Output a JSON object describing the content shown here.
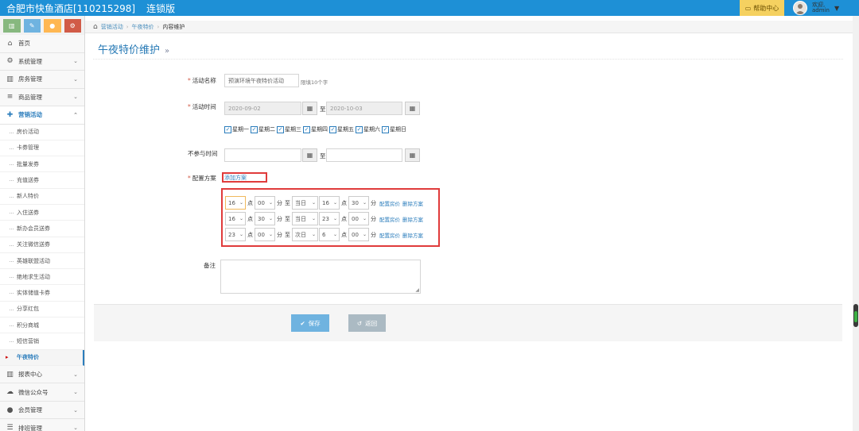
{
  "app": {
    "hotel_name": "合肥市快鱼酒店[110215298]",
    "edition": "连锁版",
    "help_label": "帮助中心",
    "welcome": "欢迎,",
    "username": "admin"
  },
  "sidebar": {
    "shortcuts": [
      "chart-icon",
      "pencil-icon",
      "users-icon",
      "cogs-icon"
    ],
    "top_items": [
      {
        "label": "首页",
        "icon": "home-icon"
      },
      {
        "label": "系统管理",
        "icon": "gear-icon"
      },
      {
        "label": "房务管理",
        "icon": "bank-icon"
      },
      {
        "label": "商品管理",
        "icon": "database-icon"
      },
      {
        "label": "营销活动",
        "icon": "gift-icon"
      }
    ],
    "marketing_sub": [
      "房价活动",
      "卡券管理",
      "批量发券",
      "充值送券",
      "新人特价",
      "入住送券",
      "新办会员送券",
      "关注微信送券",
      "英雄联盟活动",
      "绝地求生活动",
      "实体储值卡券",
      "分享红包",
      "积分商城",
      "短信营销",
      "午夜特价"
    ],
    "bottom_items": [
      {
        "label": "报表中心",
        "icon": "bar-chart-icon"
      },
      {
        "label": "微信公众号",
        "icon": "cloud-icon"
      },
      {
        "label": "会员管理",
        "icon": "group-icon"
      },
      {
        "label": "排班管理",
        "icon": "list-icon"
      }
    ]
  },
  "breadcrumb": {
    "items": [
      "营销活动",
      "午夜特价",
      "内容维护"
    ]
  },
  "page": {
    "title": "午夜特价维护",
    "title_suffix": "»"
  },
  "form": {
    "name_label": "活动名称",
    "name_value": "预演环境午夜特价活动",
    "name_hint": "限填10个字",
    "time_label": "活动时间",
    "start_date": "2020-09-02",
    "end_date": "2020-10-03",
    "to": "至",
    "weekdays": [
      "星期一",
      "星期二",
      "星期三",
      "星期四",
      "星期五",
      "星期六",
      "星期日"
    ],
    "exclude_label": "不参与时间",
    "exclude_start": "",
    "exclude_end": "",
    "plan_label": "配置方案",
    "add_plan": "添加方案",
    "hour_unit": "点",
    "minute_unit": "分",
    "to_short": "至",
    "config_price": "配置房价",
    "delete_plan": "删除方案",
    "plans": [
      {
        "start_hour": "16",
        "start_min": "00",
        "day": "当日",
        "end_hour": "16",
        "end_min": "30"
      },
      {
        "start_hour": "16",
        "start_min": "30",
        "day": "当日",
        "end_hour": "23",
        "end_min": "00"
      },
      {
        "start_hour": "23",
        "start_min": "00",
        "day": "次日",
        "end_hour": "6",
        "end_min": "00"
      }
    ],
    "remark_label": "备注",
    "remark_value": ""
  },
  "actions": {
    "save": "保存",
    "back": "返回"
  },
  "colors": {
    "topbar": "#1e90d6",
    "accent": "#2b7dbc",
    "highlight_box": "#e03b3b",
    "save_button": "#6fb3e0",
    "back_button": "#abbac3"
  }
}
